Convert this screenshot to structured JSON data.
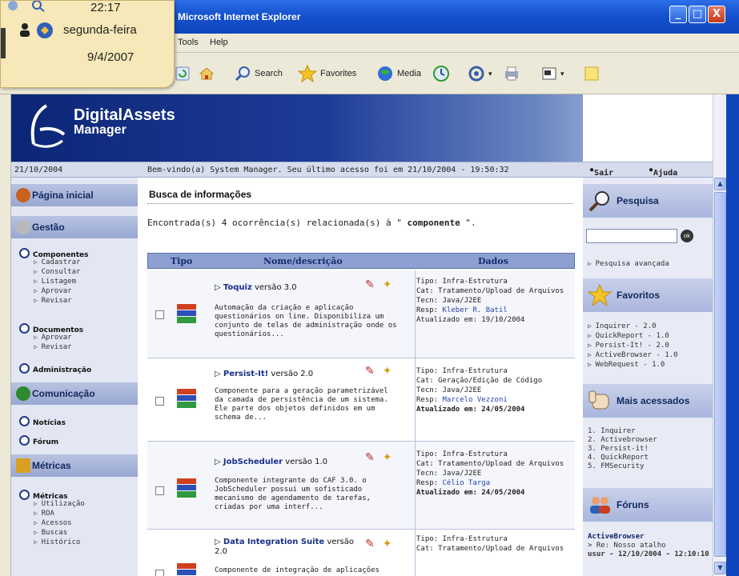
{
  "window": {
    "title": "Microsoft Internet Explorer",
    "controls": {
      "minimize": "_",
      "maximize": "□",
      "close": "X"
    }
  },
  "menu": {
    "items": [
      "Tools",
      "Help"
    ]
  },
  "toolbar": {
    "search": "Search",
    "favorites": "Favorites",
    "media": "Media"
  },
  "clock": {
    "time": "22:17",
    "day": "segunda-feira",
    "date": "9/4/2007"
  },
  "banner": {
    "brand_line1": "DigitalAssets",
    "brand_line2": "Manager"
  },
  "infobar": {
    "date": "21/10/2004",
    "welcome": "Bem-vindo(a) System Manager. Seu último acesso foi em 21/10/2004 - 19:50:32",
    "exit": "Sair",
    "help": "Ajuda"
  },
  "left": {
    "home": "Página inicial",
    "gestao": "Gestão",
    "componentes": "Componentes",
    "componentes_items": [
      "Cadastrar",
      "Consultar",
      "Listagem",
      "Aprovar",
      "Revisar"
    ],
    "documentos": "Documentos",
    "documentos_items": [
      "Aprovar",
      "Revisar"
    ],
    "administracao": "Administração",
    "comunicacao": "Comunicação",
    "noticias": "Notícias",
    "forum": "Fórum",
    "metricas_head": "Métricas",
    "metricas": "Métricas",
    "metricas_items": [
      "Utilização",
      "ROA",
      "Acessos",
      "Buscas",
      "Histórico"
    ]
  },
  "main": {
    "heading": "Busca de informações",
    "found_prefix": "Encontrada(s) 4 ocorrência(s) relacionada(s) à \" ",
    "found_term": "componente",
    "found_suffix": " \".",
    "columns": {
      "tipo": "Tipo",
      "nome": "Nome/descrição",
      "dados": "Dados"
    },
    "rows": [
      {
        "name": "Toquiz",
        "version": " versão 3.0",
        "desc": "Automação da criação e aplicação questionários on line. Disponibiliza um conjunto de telas de administração onde os questionários...",
        "tipo": "Tipo: Infra-Estrutura",
        "cat": "Cat: Tratamento/Upload de Arquivos",
        "tecn": "Tecn: Java/J2EE",
        "resp_label": "Resp: ",
        "resp": "Kleber R. Batil",
        "atual": "Atualizado em: 19/10/2004"
      },
      {
        "name": "Persist-It!",
        "version": " versão 2.0",
        "desc": "Componente para a geração parametrizável da camada de persistência de um sistema. Ele parte dos objetos definidos em um schema de...",
        "tipo": "Tipo: Infra-Estrutura",
        "cat": "Cat: Geração/Edição de Código",
        "tecn": "Tecn: Java/J2EE",
        "resp_label": "Resp: ",
        "resp": "Marcelo Vezzoni",
        "atual": "Atualizado em: 24/05/2004"
      },
      {
        "name": "JobScheduler",
        "version": " versão 1.0",
        "desc": "Componente integrante do CAF 3.0. o JobScheduler possui um sofisticado mecanismo de agendamento de tarefas, criadas por uma interf...",
        "tipo": "Tipo: Infra-Estrutura",
        "cat": "Cat: Tratamento/Upload de Arquivos",
        "tecn": "Tecn: Java/J2EE",
        "resp_label": "Resp: ",
        "resp": "Célio Targa",
        "atual": "Atualizado em: 24/05/2004"
      },
      {
        "name": "Data Integration Suite",
        "version": " versão 2.0",
        "desc": "Componente de integração de aplicações",
        "tipo": "Tipo: Infra-Estrutura",
        "cat": "Cat: Tratamento/Upload de Arquivos"
      }
    ]
  },
  "right": {
    "pesquisa": "Pesquisa",
    "go": "ok",
    "pesquisa_avancada": "Pesquisa avançada",
    "favoritos": "Favoritos",
    "favoritos_items": [
      "Inquirer - 2.0",
      "QuickReport - 1.0",
      "Persist-It! - 2.0",
      "ActiveBrowser - 1.0",
      "WebRequest - 1.0"
    ],
    "mais_acessados": "Mais acessados",
    "mais_items": [
      "1. Inquirer",
      "2. Activebrowser",
      "3. Persist-it!",
      "4. QuickReport",
      "5. FMSecurity"
    ],
    "foruns": "Fóruns",
    "forum_title": "ActiveBrowser",
    "forum_post": "> Re: Nosso atalho",
    "forum_date": "usur - 12/10/2004 - 12:10:10"
  },
  "colors": {
    "nav_blue": "#1d3c98",
    "panel": "#e3e7f3",
    "header": "#8ea0d2"
  }
}
